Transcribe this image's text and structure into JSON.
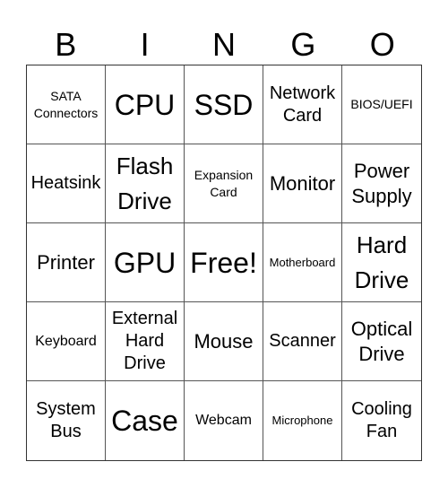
{
  "header": {
    "letters": [
      "B",
      "I",
      "N",
      "G",
      "O"
    ]
  },
  "card": {
    "cells": [
      {
        "text": "SATA Connectors",
        "lines": [
          "SATA",
          "Connectors"
        ],
        "size": "s-sm"
      },
      {
        "text": "CPU",
        "lines": [
          "CPU"
        ],
        "size": "s-xxl"
      },
      {
        "text": "SSD",
        "lines": [
          "SSD"
        ],
        "size": "s-xxl"
      },
      {
        "text": "Network Card",
        "lines": [
          "Network",
          "Card"
        ],
        "size": "s-lg"
      },
      {
        "text": "BIOS/UEFI",
        "lines": [
          "BIOS/UEFI"
        ],
        "size": "s-sm"
      },
      {
        "text": "Heatsink",
        "lines": [
          "Heatsink"
        ],
        "size": "s-lg"
      },
      {
        "text": "Flash Drive",
        "lines": [
          "Flash",
          "Drive"
        ],
        "size": "s-xl"
      },
      {
        "text": "Expansion Card",
        "lines": [
          "Expansion",
          "Card"
        ],
        "size": "s-sm"
      },
      {
        "text": "Monitor",
        "lines": [
          "Monitor"
        ],
        "size": "s-mlg"
      },
      {
        "text": "Power Supply",
        "lines": [
          "Power",
          "Supply"
        ],
        "size": "s-mlg"
      },
      {
        "text": "Printer",
        "lines": [
          "Printer"
        ],
        "size": "s-mlg"
      },
      {
        "text": "GPU",
        "lines": [
          "GPU"
        ],
        "size": "s-xxl"
      },
      {
        "text": "Free!",
        "lines": [
          "Free!"
        ],
        "size": "s-xxl"
      },
      {
        "text": "Motherboard",
        "lines": [
          "Motherboard"
        ],
        "size": "s-xs"
      },
      {
        "text": "Hard Drive",
        "lines": [
          "Hard",
          "Drive"
        ],
        "size": "s-xl"
      },
      {
        "text": "Keyboard",
        "lines": [
          "Keyboard"
        ],
        "size": "s-md"
      },
      {
        "text": "External Hard Drive",
        "lines": [
          "External",
          "Hard",
          "Drive"
        ],
        "size": "s-lg"
      },
      {
        "text": "Mouse",
        "lines": [
          "Mouse"
        ],
        "size": "s-mlg"
      },
      {
        "text": "Scanner",
        "lines": [
          "Scanner"
        ],
        "size": "s-lg"
      },
      {
        "text": "Optical Drive",
        "lines": [
          "Optical",
          "Drive"
        ],
        "size": "s-mlg"
      },
      {
        "text": "System Bus",
        "lines": [
          "System",
          "Bus"
        ],
        "size": "s-lg"
      },
      {
        "text": "Case",
        "lines": [
          "Case"
        ],
        "size": "s-xxl"
      },
      {
        "text": "Webcam",
        "lines": [
          "Webcam"
        ],
        "size": "s-md"
      },
      {
        "text": "Microphone",
        "lines": [
          "Microphone"
        ],
        "size": "s-xs"
      },
      {
        "text": "Cooling Fan",
        "lines": [
          "Cooling",
          "Fan"
        ],
        "size": "s-lg"
      }
    ]
  }
}
